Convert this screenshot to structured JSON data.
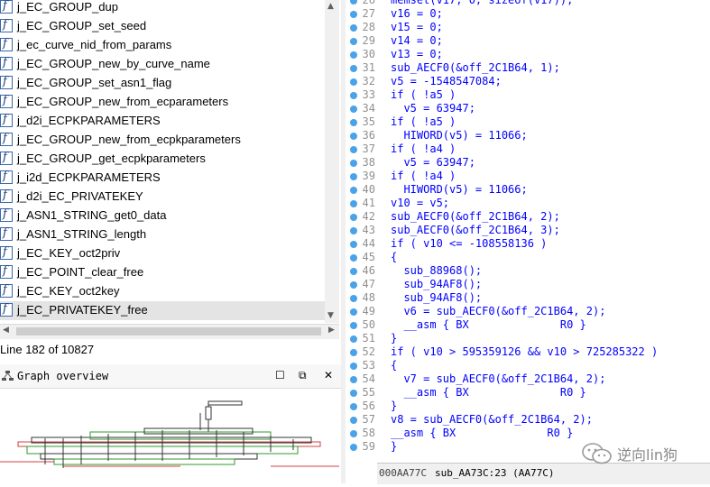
{
  "functions": {
    "icon_glyph": "f",
    "items": [
      {
        "label": "j_EC_GROUP_dup",
        "selected": false
      },
      {
        "label": "j_EC_GROUP_set_seed",
        "selected": false
      },
      {
        "label": "j_ec_curve_nid_from_params",
        "selected": false
      },
      {
        "label": "j_EC_GROUP_new_by_curve_name",
        "selected": false
      },
      {
        "label": "j_EC_GROUP_set_asn1_flag",
        "selected": false
      },
      {
        "label": "j_EC_GROUP_new_from_ecparameters",
        "selected": false
      },
      {
        "label": "j_d2i_ECPKPARAMETERS",
        "selected": false
      },
      {
        "label": "j_EC_GROUP_new_from_ecpkparameters",
        "selected": false
      },
      {
        "label": "j_EC_GROUP_get_ecpkparameters",
        "selected": false
      },
      {
        "label": "j_i2d_ECPKPARAMETERS",
        "selected": false
      },
      {
        "label": "j_d2i_EC_PRIVATEKEY",
        "selected": false
      },
      {
        "label": "j_ASN1_STRING_get0_data",
        "selected": false
      },
      {
        "label": "j_ASN1_STRING_length",
        "selected": false
      },
      {
        "label": "j_EC_KEY_oct2priv",
        "selected": false
      },
      {
        "label": "j_EC_POINT_clear_free",
        "selected": false
      },
      {
        "label": "j_EC_KEY_oct2key",
        "selected": false
      },
      {
        "label": "j_EC_PRIVATEKEY_free",
        "selected": true
      }
    ]
  },
  "line_status": "Line 182 of 10827",
  "graph_overview": {
    "title": "Graph overview",
    "buttons": {
      "restore": "☐",
      "float": "⧉",
      "close": "✕"
    }
  },
  "code": {
    "lines": [
      {
        "num": "26",
        "text": "memset(v17, 0, sizeof(v17));"
      },
      {
        "num": "27",
        "text": "v16 = 0;"
      },
      {
        "num": "28",
        "text": "v15 = 0;"
      },
      {
        "num": "29",
        "text": "v14 = 0;"
      },
      {
        "num": "30",
        "text": "v13 = 0;"
      },
      {
        "num": "31",
        "text": "sub_AECF0(&off_2C1B64, 1);"
      },
      {
        "num": "32",
        "text": "v5 = -1548547084;"
      },
      {
        "num": "33",
        "text": "if ( !a5 )"
      },
      {
        "num": "34",
        "text": "  v5 = 63947;"
      },
      {
        "num": "35",
        "text": "if ( !a5 )"
      },
      {
        "num": "36",
        "text": "  HIWORD(v5) = 11066;"
      },
      {
        "num": "37",
        "text": "if ( !a4 )"
      },
      {
        "num": "38",
        "text": "  v5 = 63947;"
      },
      {
        "num": "39",
        "text": "if ( !a4 )"
      },
      {
        "num": "40",
        "text": "  HIWORD(v5) = 11066;"
      },
      {
        "num": "41",
        "text": "v10 = v5;"
      },
      {
        "num": "42",
        "text": "sub_AECF0(&off_2C1B64, 2);"
      },
      {
        "num": "43",
        "text": "sub_AECF0(&off_2C1B64, 3);"
      },
      {
        "num": "44",
        "text": "if ( v10 <= -108558136 )"
      },
      {
        "num": "45",
        "text": "{"
      },
      {
        "num": "46",
        "text": "  sub_88968();"
      },
      {
        "num": "47",
        "text": "  sub_94AF8();"
      },
      {
        "num": "48",
        "text": "  sub_94AF8();"
      },
      {
        "num": "49",
        "text": "  v6 = sub_AECF0(&off_2C1B64, 2);"
      },
      {
        "num": "50",
        "text": "  __asm { BX              R0 }"
      },
      {
        "num": "51",
        "text": "}"
      },
      {
        "num": "52",
        "text": "if ( v10 > 595359126 && v10 > 725285322 )"
      },
      {
        "num": "53",
        "text": "{"
      },
      {
        "num": "54",
        "text": "  v7 = sub_AECF0(&off_2C1B64, 2);"
      },
      {
        "num": "55",
        "text": "  __asm { BX              R0 }"
      },
      {
        "num": "56",
        "text": "}"
      },
      {
        "num": "57",
        "text": "v8 = sub_AECF0(&off_2C1B64, 2);"
      },
      {
        "num": "58",
        "text": "__asm { BX              R0 }"
      },
      {
        "num": "59",
        "text": "}"
      }
    ]
  },
  "status_bar": {
    "address": "000AA77C",
    "function": "sub_AA73C:23 (AA77C)"
  },
  "watermark": {
    "text": "逆向lin狗"
  },
  "colors": {
    "keyword_blue": "#0000ff",
    "breakpoint_dot": "#4aa2e8",
    "selection": "#e4e4e4"
  }
}
